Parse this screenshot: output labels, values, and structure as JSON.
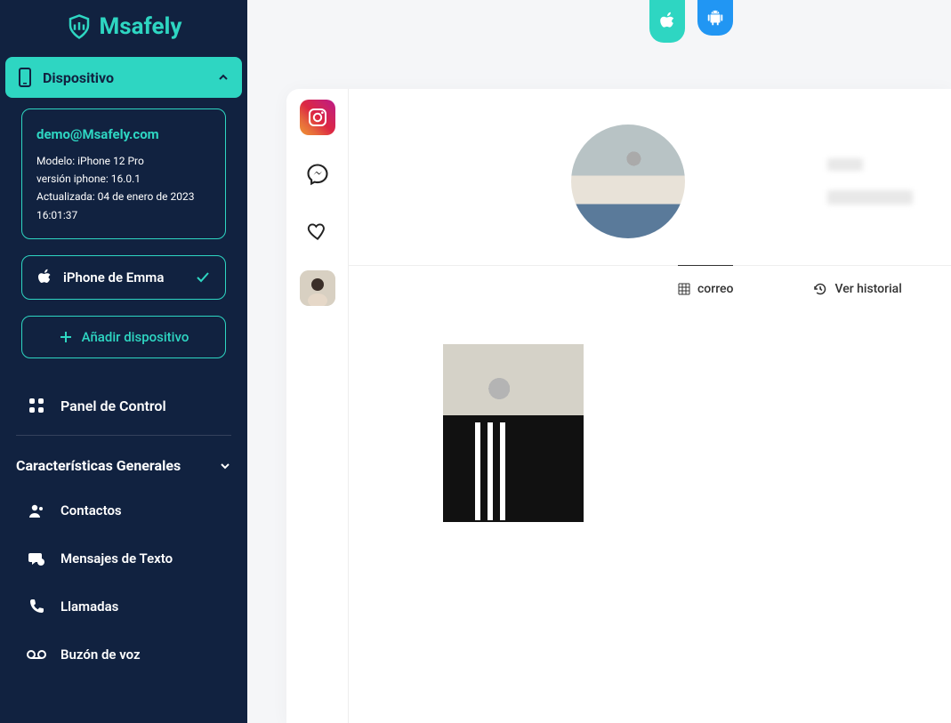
{
  "brand": {
    "name": "Msafely"
  },
  "colors": {
    "accent": "#2ed6c2",
    "sidebar_bg": "#112240",
    "android_blue": "#2196f3"
  },
  "sidebar": {
    "device_toggle_label": "Dispositivo",
    "account_email": "demo@Msafely.com",
    "model_line": "Modelo: iPhone 12 Pro",
    "version_line": "versión iphone: 16.0.1",
    "updated_line": "Actualizada: 04 de enero de 2023 16:01:37",
    "selected_device": "iPhone de Emma",
    "add_device_label": "Añadir dispositivo",
    "panel_label": "Panel de Control",
    "features_label": "Características Generales",
    "items": [
      {
        "label": "Contactos"
      },
      {
        "label": "Mensajes de Texto"
      },
      {
        "label": "Llamadas"
      },
      {
        "label": "Buzón de voz"
      }
    ]
  },
  "tabs": {
    "correo": "correo",
    "historial": "Ver historial"
  },
  "icon_column": {
    "items": [
      "instagram",
      "messenger",
      "likes",
      "avatar"
    ]
  }
}
